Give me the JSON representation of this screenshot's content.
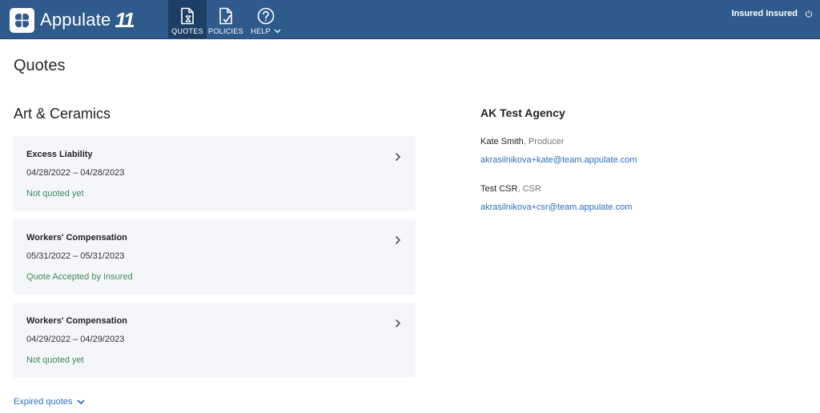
{
  "app": {
    "brand": "Appulate",
    "brand_mark": "11"
  },
  "nav": [
    {
      "label": "QUOTES",
      "icon": "quotes-document-icon",
      "active": true
    },
    {
      "label": "POLICIES",
      "icon": "policies-document-check-icon",
      "active": false
    },
    {
      "label": "HELP",
      "icon": "help-question-icon",
      "active": false
    }
  ],
  "user": {
    "name": "Insured Insured",
    "icon": "power-icon"
  },
  "page": {
    "title": "Quotes"
  },
  "insured": {
    "name": "Art & Ceramics"
  },
  "quotes": [
    {
      "title": "Excess Liability",
      "dates": "04/28/2022 – 04/28/2023",
      "status": "Not quoted yet"
    },
    {
      "title": "Workers' Compensation",
      "dates": "05/31/2022 – 05/31/2023",
      "status": "Quote Accepted by Insured"
    },
    {
      "title": "Workers' Compensation",
      "dates": "04/29/2022 – 04/29/2023",
      "status": "Not quoted yet"
    }
  ],
  "expired": {
    "label": "Expired quotes"
  },
  "agency": {
    "name": "AK Test Agency",
    "contacts": [
      {
        "name": "Kate Smith",
        "role": ", Producer",
        "email": "akrasilnikova+kate@team.appulate.com"
      },
      {
        "name": "Test CSR",
        "role": ", CSR",
        "email": "akrasilnikova+csr@team.appulate.com"
      }
    ]
  },
  "colors": {
    "header": "#2e5a8c",
    "active_nav": "#1d3f66",
    "status_green": "#3f8a5a",
    "link_blue": "#2e6fba",
    "card_bg": "#f4f6f9"
  }
}
